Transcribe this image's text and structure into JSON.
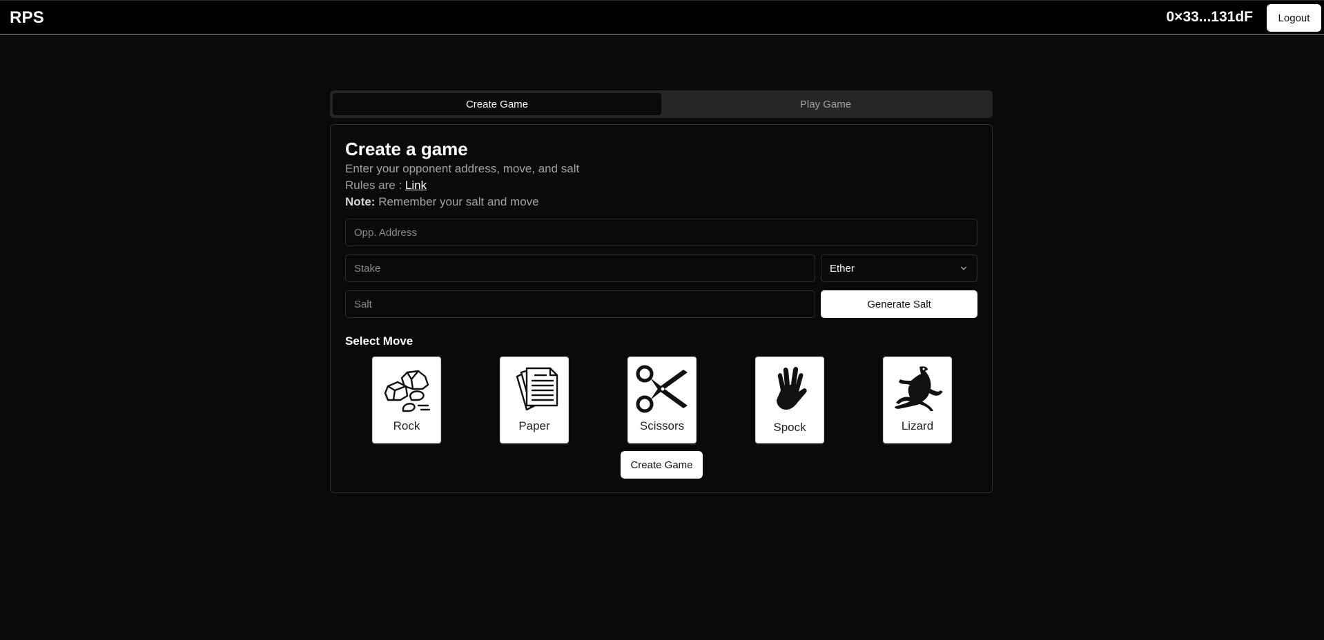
{
  "header": {
    "brand": "RPS",
    "wallet_address": "0×33...131dF",
    "logout_label": "Logout"
  },
  "tabs": [
    {
      "label": "Create Game",
      "active": true
    },
    {
      "label": "Play Game",
      "active": false
    }
  ],
  "card": {
    "title": "Create a game",
    "description": "Enter your opponent address, move, and salt",
    "rules_prefix": "Rules are :",
    "rules_link": "Link",
    "note_label": "Note:",
    "note_text": "Remember your salt and move"
  },
  "form": {
    "opponent_placeholder": "Opp. Address",
    "opponent_value": "",
    "stake_placeholder": "Stake",
    "stake_value": "",
    "currency_selected": "Ether",
    "salt_placeholder": "Salt",
    "salt_value": "",
    "generate_salt_label": "Generate Salt"
  },
  "moves": {
    "section_label": "Select Move",
    "items": [
      {
        "label": "Rock",
        "icon": "rock-icon"
      },
      {
        "label": "Paper",
        "icon": "paper-icon"
      },
      {
        "label": "Scissors",
        "icon": "scissors-icon"
      },
      {
        "label": "Spock",
        "icon": "spock-hand-icon"
      },
      {
        "label": "Lizard",
        "icon": "lizard-icon"
      }
    ]
  },
  "submit_label": "Create Game"
}
